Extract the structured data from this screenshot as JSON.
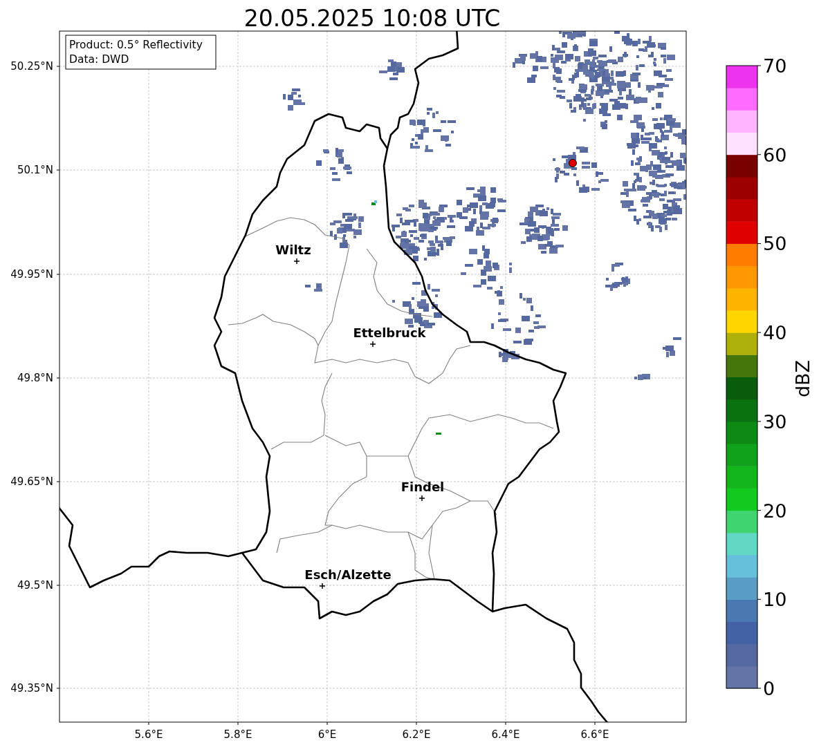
{
  "title": "20.05.2025 10:08 UTC",
  "info_box": [
    "Product: 0.5° Reflectivity",
    "Data: DWD"
  ],
  "map": {
    "xticks": [
      "5.6°E",
      "5.8°E",
      "6°E",
      "6.2°E",
      "6.4°E",
      "6.6°E"
    ],
    "yticks": [
      "50.25°N",
      "50.1°N",
      "49.95°N",
      "49.8°N",
      "49.65°N",
      "49.5°N",
      "49.35°N"
    ],
    "cities": [
      {
        "name": "Wiltz"
      },
      {
        "name": "Ettelbruck"
      },
      {
        "name": "Findel"
      },
      {
        "name": "Esch/Alzette"
      }
    ]
  },
  "colorbar": {
    "label": "dBZ",
    "ticks": [
      "70",
      "60",
      "50",
      "40",
      "30",
      "20",
      "10",
      "0"
    ],
    "bins": [
      {
        "color": "#6474a6"
      },
      {
        "color": "#5568a0"
      },
      {
        "color": "#4461a3"
      },
      {
        "color": "#4a78b0"
      },
      {
        "color": "#5a9dc4"
      },
      {
        "color": "#66bfdb"
      },
      {
        "color": "#60d8c4"
      },
      {
        "color": "#40d470"
      },
      {
        "color": "#12c920"
      },
      {
        "color": "#12b61c"
      },
      {
        "color": "#10a21a"
      },
      {
        "color": "#0d8a14"
      },
      {
        "color": "#0a7210"
      },
      {
        "color": "#085c0c"
      },
      {
        "color": "#44760c"
      },
      {
        "color": "#b0b00a"
      },
      {
        "color": "#ffd700"
      },
      {
        "color": "#ffb400"
      },
      {
        "color": "#ff9800"
      },
      {
        "color": "#ff7c00"
      },
      {
        "color": "#e00000"
      },
      {
        "color": "#c00000"
      },
      {
        "color": "#9c0000"
      },
      {
        "color": "#780000"
      },
      {
        "color": "#ffe0ff"
      },
      {
        "color": "#ffb4ff"
      },
      {
        "color": "#ff6cff"
      },
      {
        "color": "#ee33ee"
      }
    ]
  }
}
